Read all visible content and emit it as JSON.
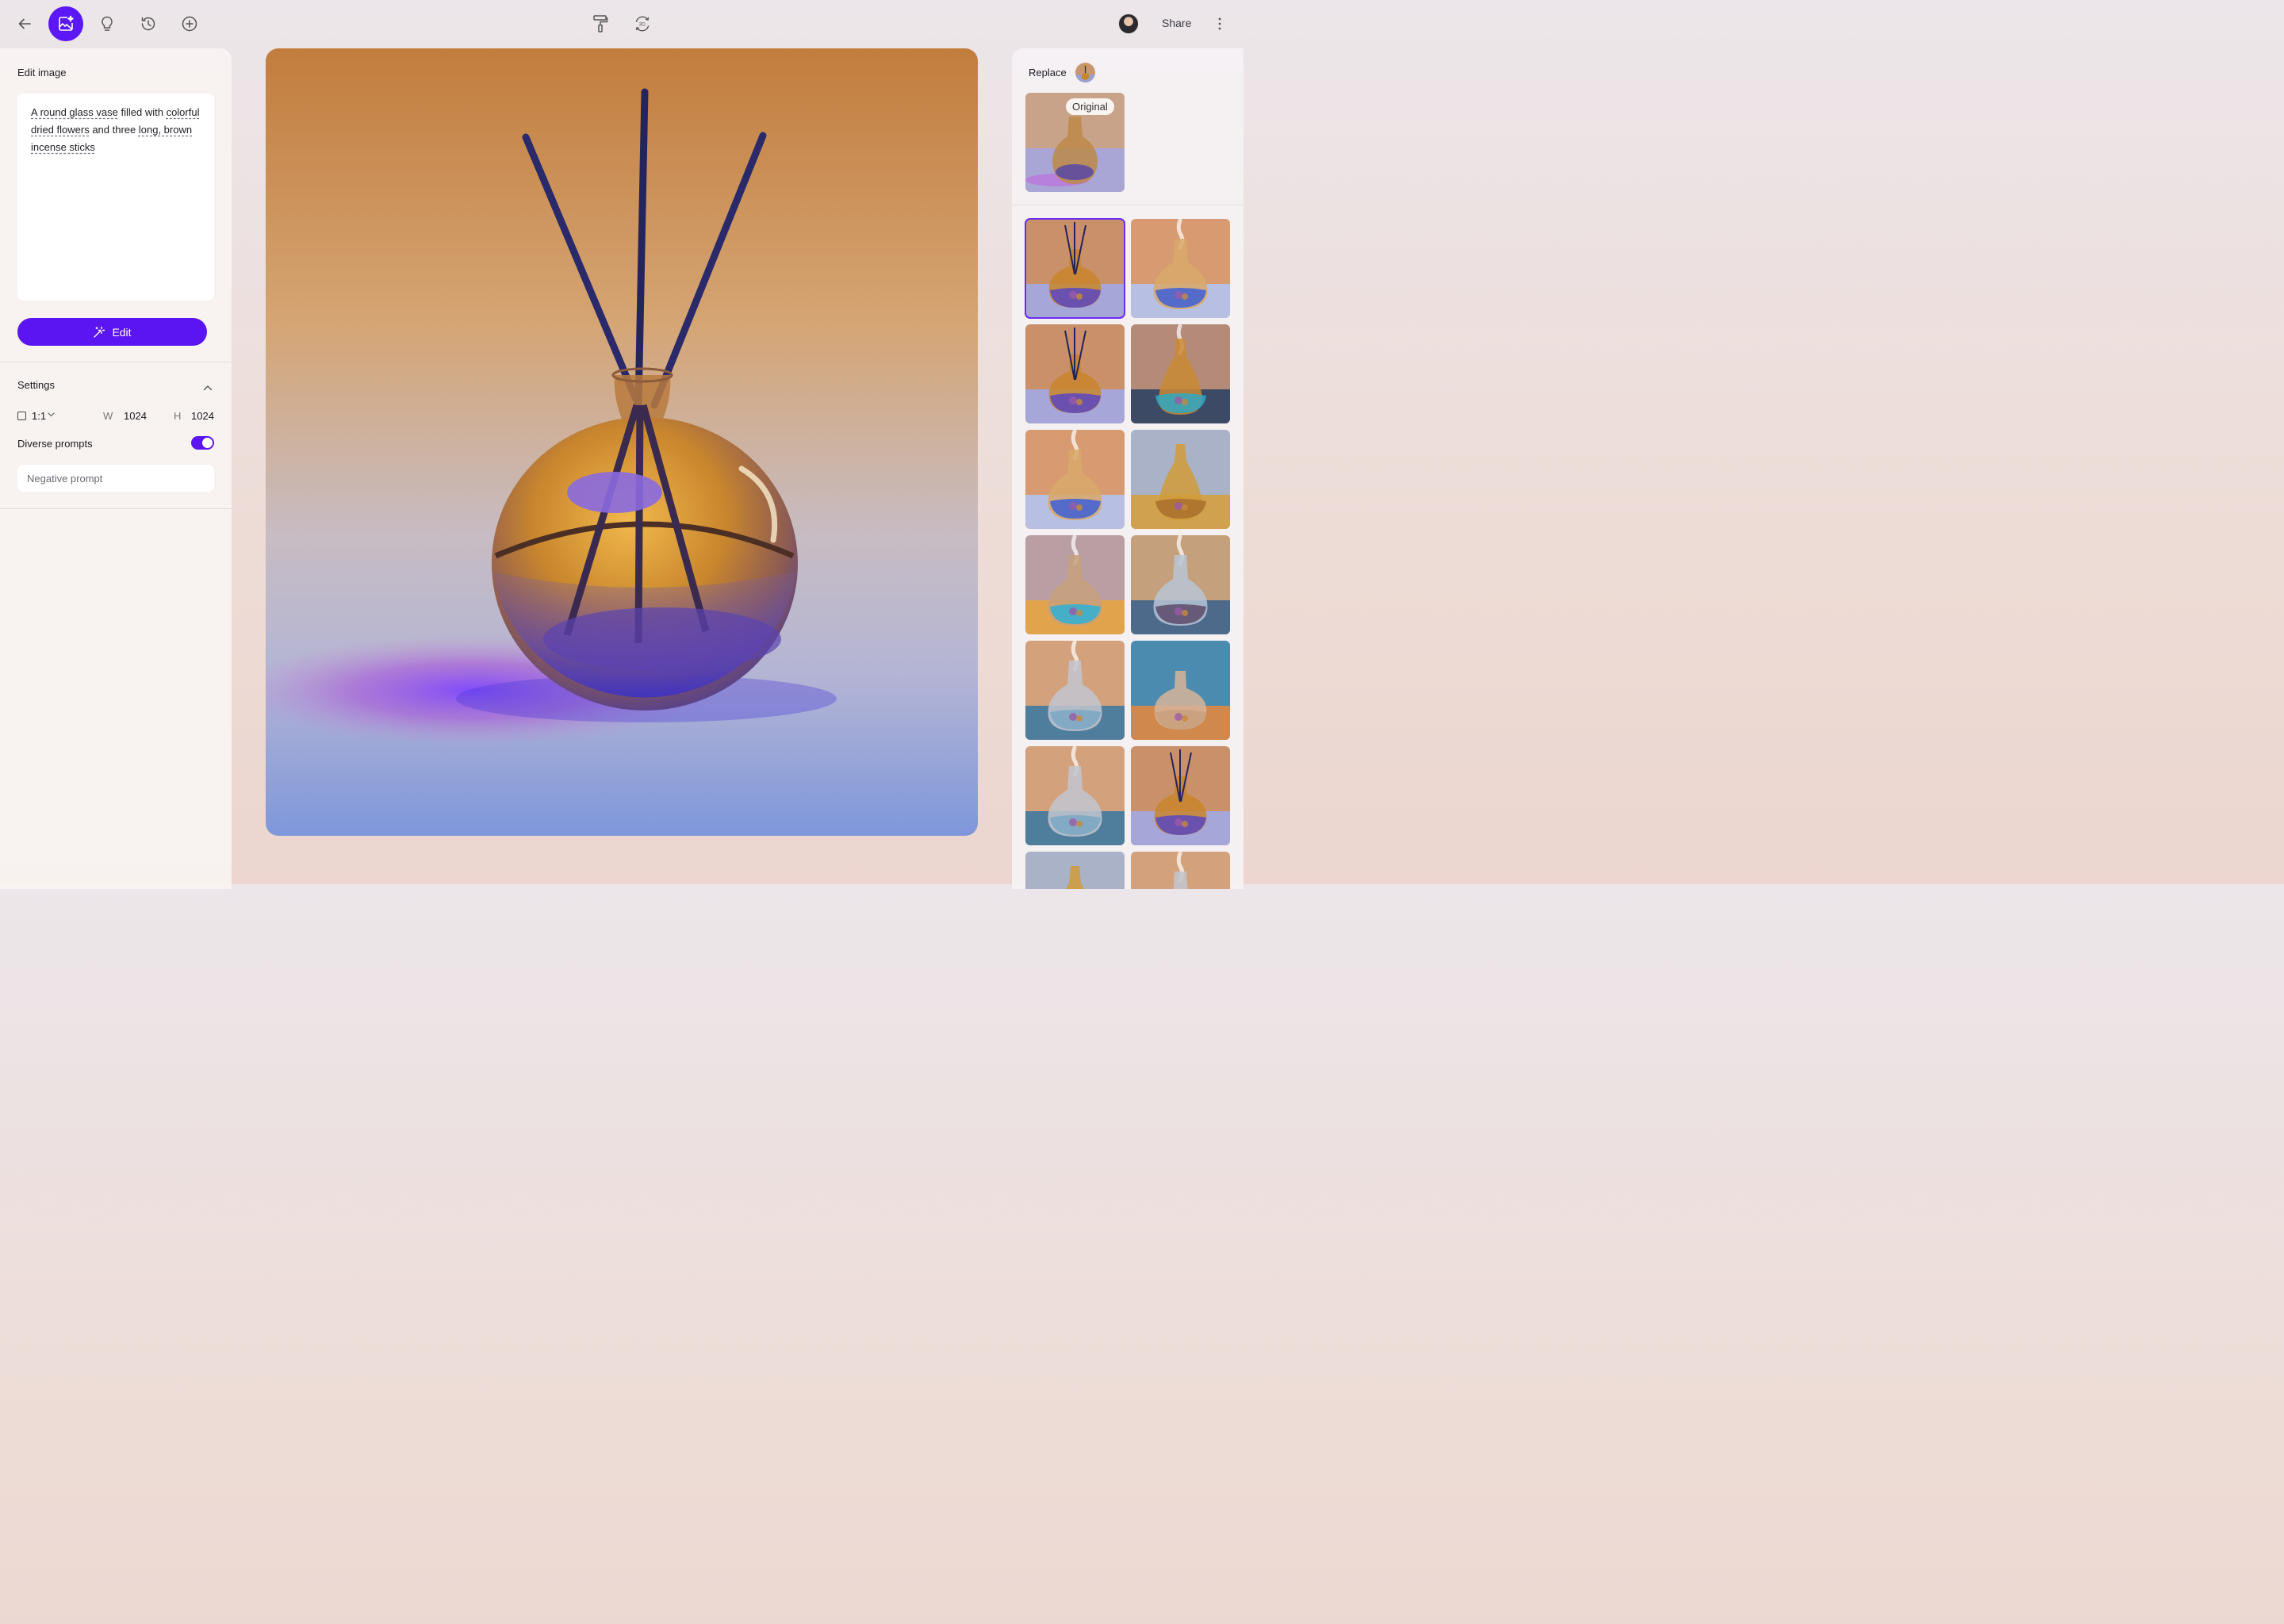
{
  "toolbar": {
    "back_icon": "arrow-left-icon",
    "tools": [
      "image-edit-icon",
      "lightbulb-icon",
      "history-icon",
      "add-circle-icon"
    ],
    "center_tools": [
      "paint-roller-icon",
      "rotate-3d-icon"
    ],
    "center_3d_label": "3D",
    "share_label": "Share",
    "more_icon": "more-vertical-icon",
    "accent": "#5b17f5"
  },
  "edit_panel": {
    "title": "Edit image",
    "prompt": {
      "p1": "A round glass vase",
      "p2": " filled with ",
      "p3": "colorful",
      "p4": "dried flowers",
      "p5": " and three ",
      "p6": "long, brown",
      "p7": "incense sticks"
    },
    "edit_button": "Edit"
  },
  "settings": {
    "label": "Settings",
    "aspect_ratio": "1:1",
    "width_label": "W",
    "width": "1024",
    "height_label": "H",
    "height": "1024",
    "diverse_prompts_label": "Diverse prompts",
    "diverse_prompts": true,
    "negative_prompt_placeholder": "Negative prompt"
  },
  "results": {
    "replace_label": "Replace",
    "original_label": "Original",
    "thumbnails": [
      {
        "style": "amber-sticks",
        "selected": true
      },
      {
        "style": "blue-smoke"
      },
      {
        "style": "amber-sticks"
      },
      {
        "style": "amber-teal"
      },
      {
        "style": "blue-smoke"
      },
      {
        "style": "amber-tall"
      },
      {
        "style": "teal-smoke"
      },
      {
        "style": "amber-tree"
      },
      {
        "style": "clear-smoke"
      },
      {
        "style": "fishbowl"
      },
      {
        "style": "clear-smoke"
      },
      {
        "style": "amber-sticks"
      },
      {
        "style": "amber-tall"
      },
      {
        "style": "clear-smoke"
      }
    ]
  }
}
